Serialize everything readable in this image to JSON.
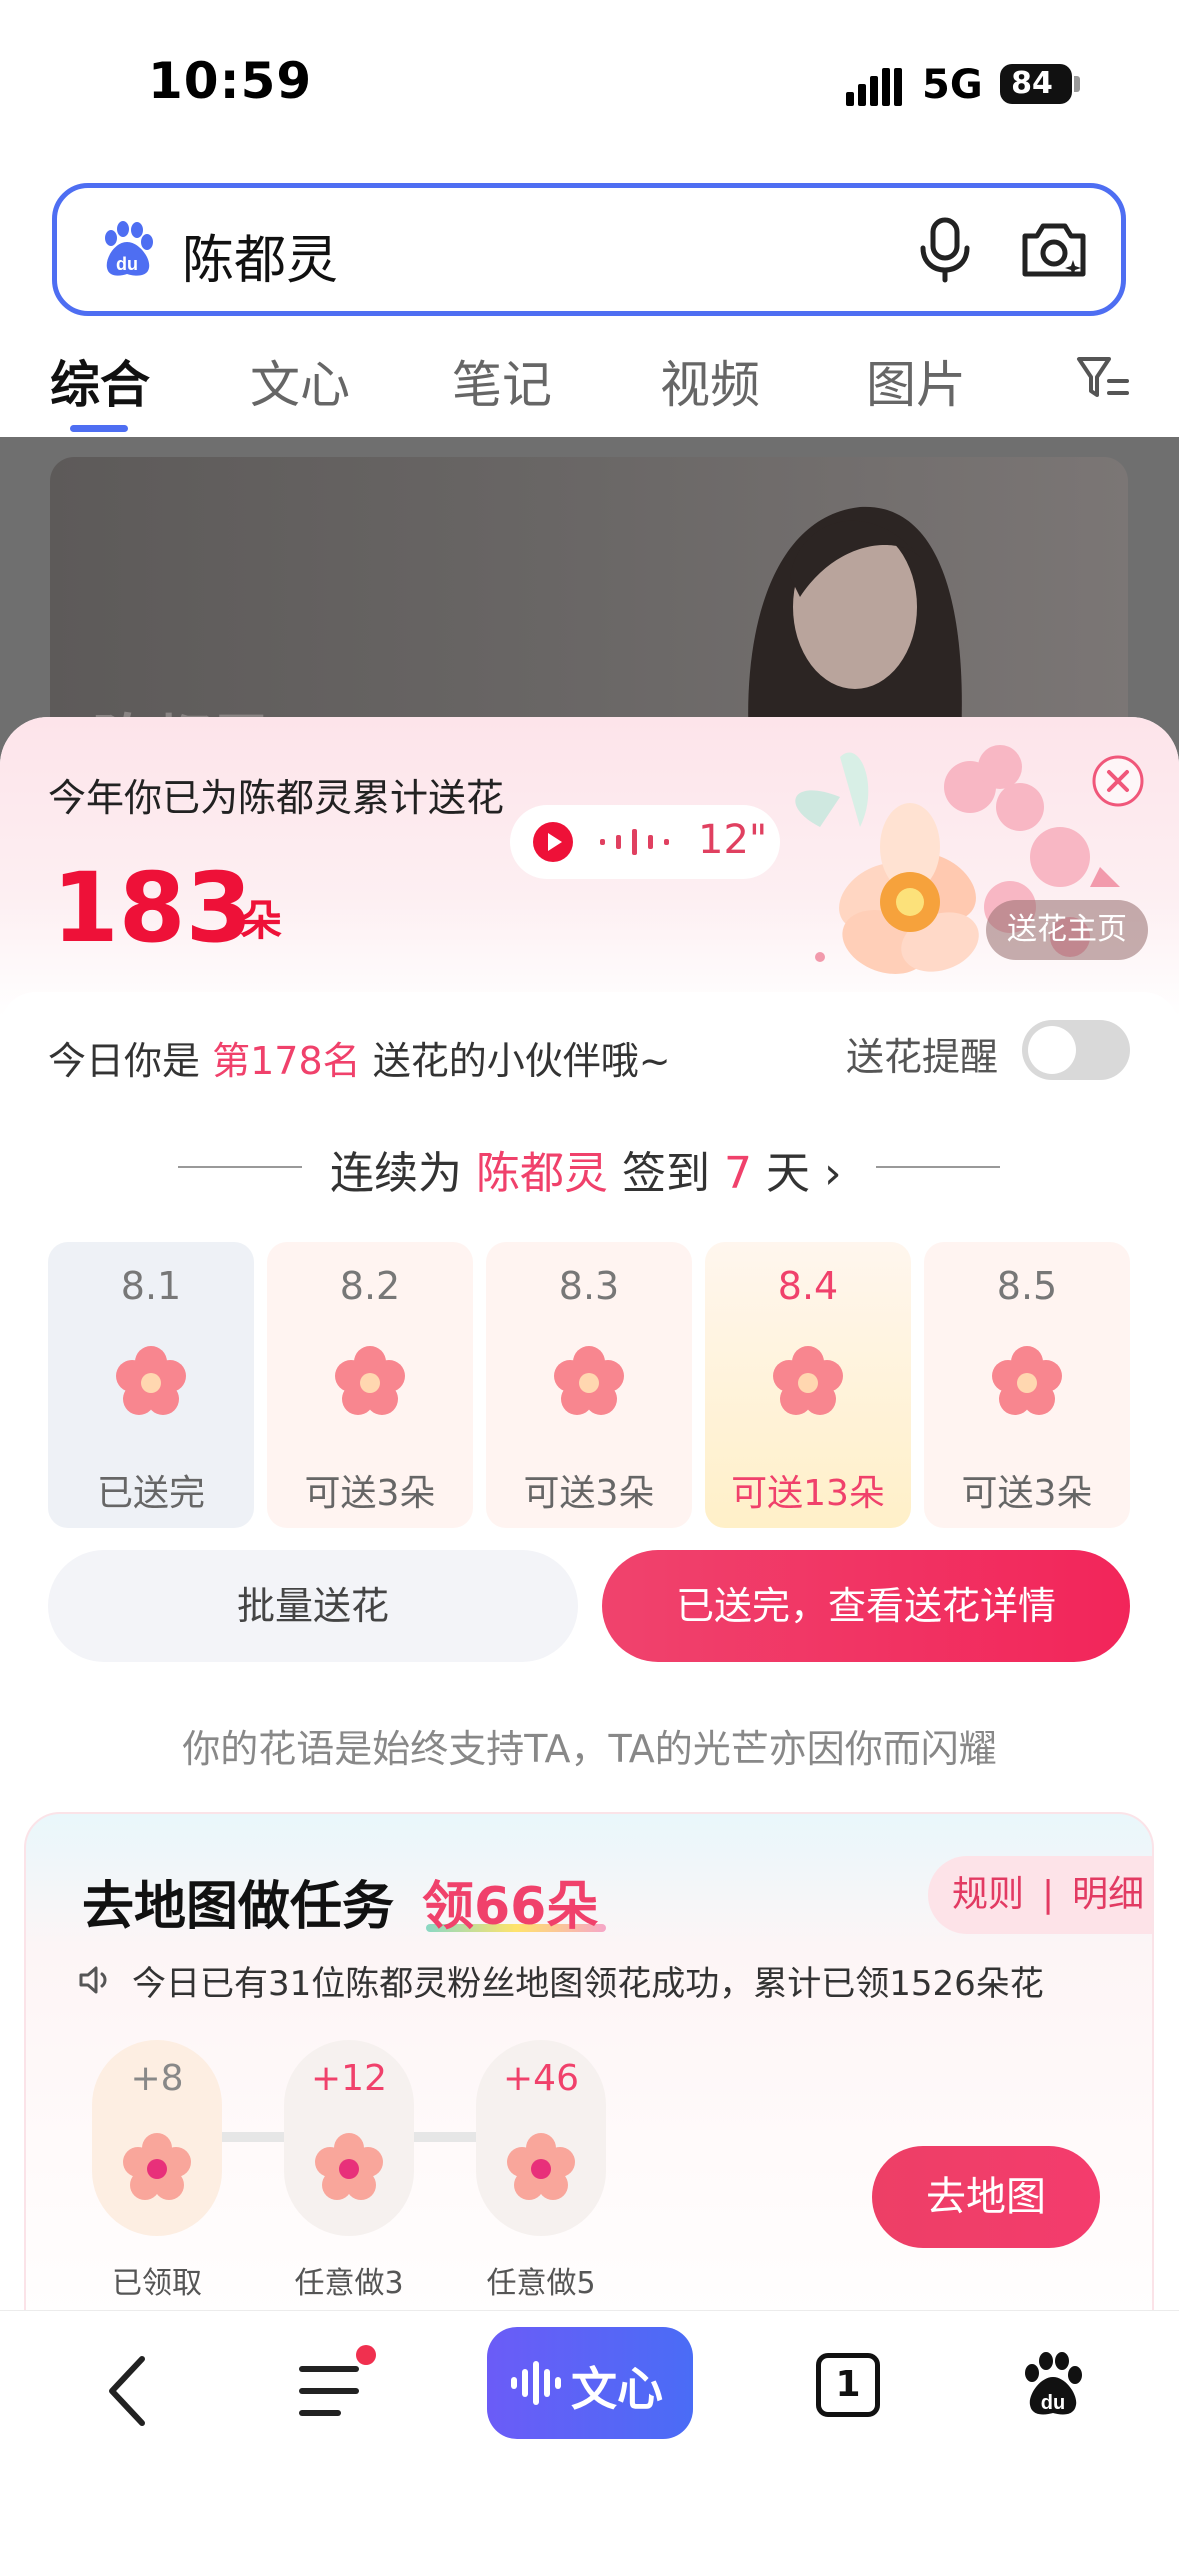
{
  "status_bar": {
    "time": "10:59",
    "network": "5G",
    "battery": "84"
  },
  "search": {
    "query": "陈都灵"
  },
  "tabs": [
    {
      "label": "综合",
      "active": true
    },
    {
      "label": "文心",
      "active": false
    },
    {
      "label": "笔记",
      "active": false
    },
    {
      "label": "视频",
      "active": false
    },
    {
      "label": "图片",
      "active": false
    }
  ],
  "hero": {
    "name": "陈都灵"
  },
  "flower_sheet": {
    "total_label": "今年你已为陈都灵累计送花",
    "total_count": "183",
    "total_unit": "朵",
    "voice_length": "12\"",
    "flower_home": "送花主页",
    "rank": {
      "prefix": "今日你是",
      "rank": "第178名",
      "suffix": "送花的小伙伴哦~"
    },
    "reminder_label": "送花提醒",
    "reminder_on": false,
    "streak": {
      "prefix": "连续为",
      "name": "陈都灵",
      "middle": "签到",
      "days": "7",
      "suffix": "天"
    },
    "days": [
      {
        "date": "8.1",
        "status": "已送完"
      },
      {
        "date": "8.2",
        "status": "可送3朵"
      },
      {
        "date": "8.3",
        "status": "可送3朵"
      },
      {
        "date": "8.4",
        "status": "可送13朵"
      },
      {
        "date": "8.5",
        "status": "可送3朵"
      }
    ],
    "batch_button": "批量送花",
    "details_button": "已送完，查看送花详情",
    "motto": "你的花语是始终支持TA，TA的光芒亦因你而闪耀"
  },
  "task_card": {
    "title": "去地图做任务",
    "reward": "领66朵",
    "rules": "规则",
    "details": "明细",
    "notice": "今日已有31位陈都灵粉丝地图领花成功，累计已领1526朵花",
    "rewards": [
      {
        "value": "+8",
        "caption": "已领取"
      },
      {
        "value": "+12",
        "caption": "任意做3"
      },
      {
        "value": "+46",
        "caption": "任意做5"
      }
    ],
    "goto_button": "去地图"
  },
  "bottom_nav": {
    "wenxin": "文心",
    "tab_count": "1"
  },
  "colors": {
    "accent": "#4e6ef2",
    "pink": "#f0416b",
    "red": "#ee1138"
  }
}
